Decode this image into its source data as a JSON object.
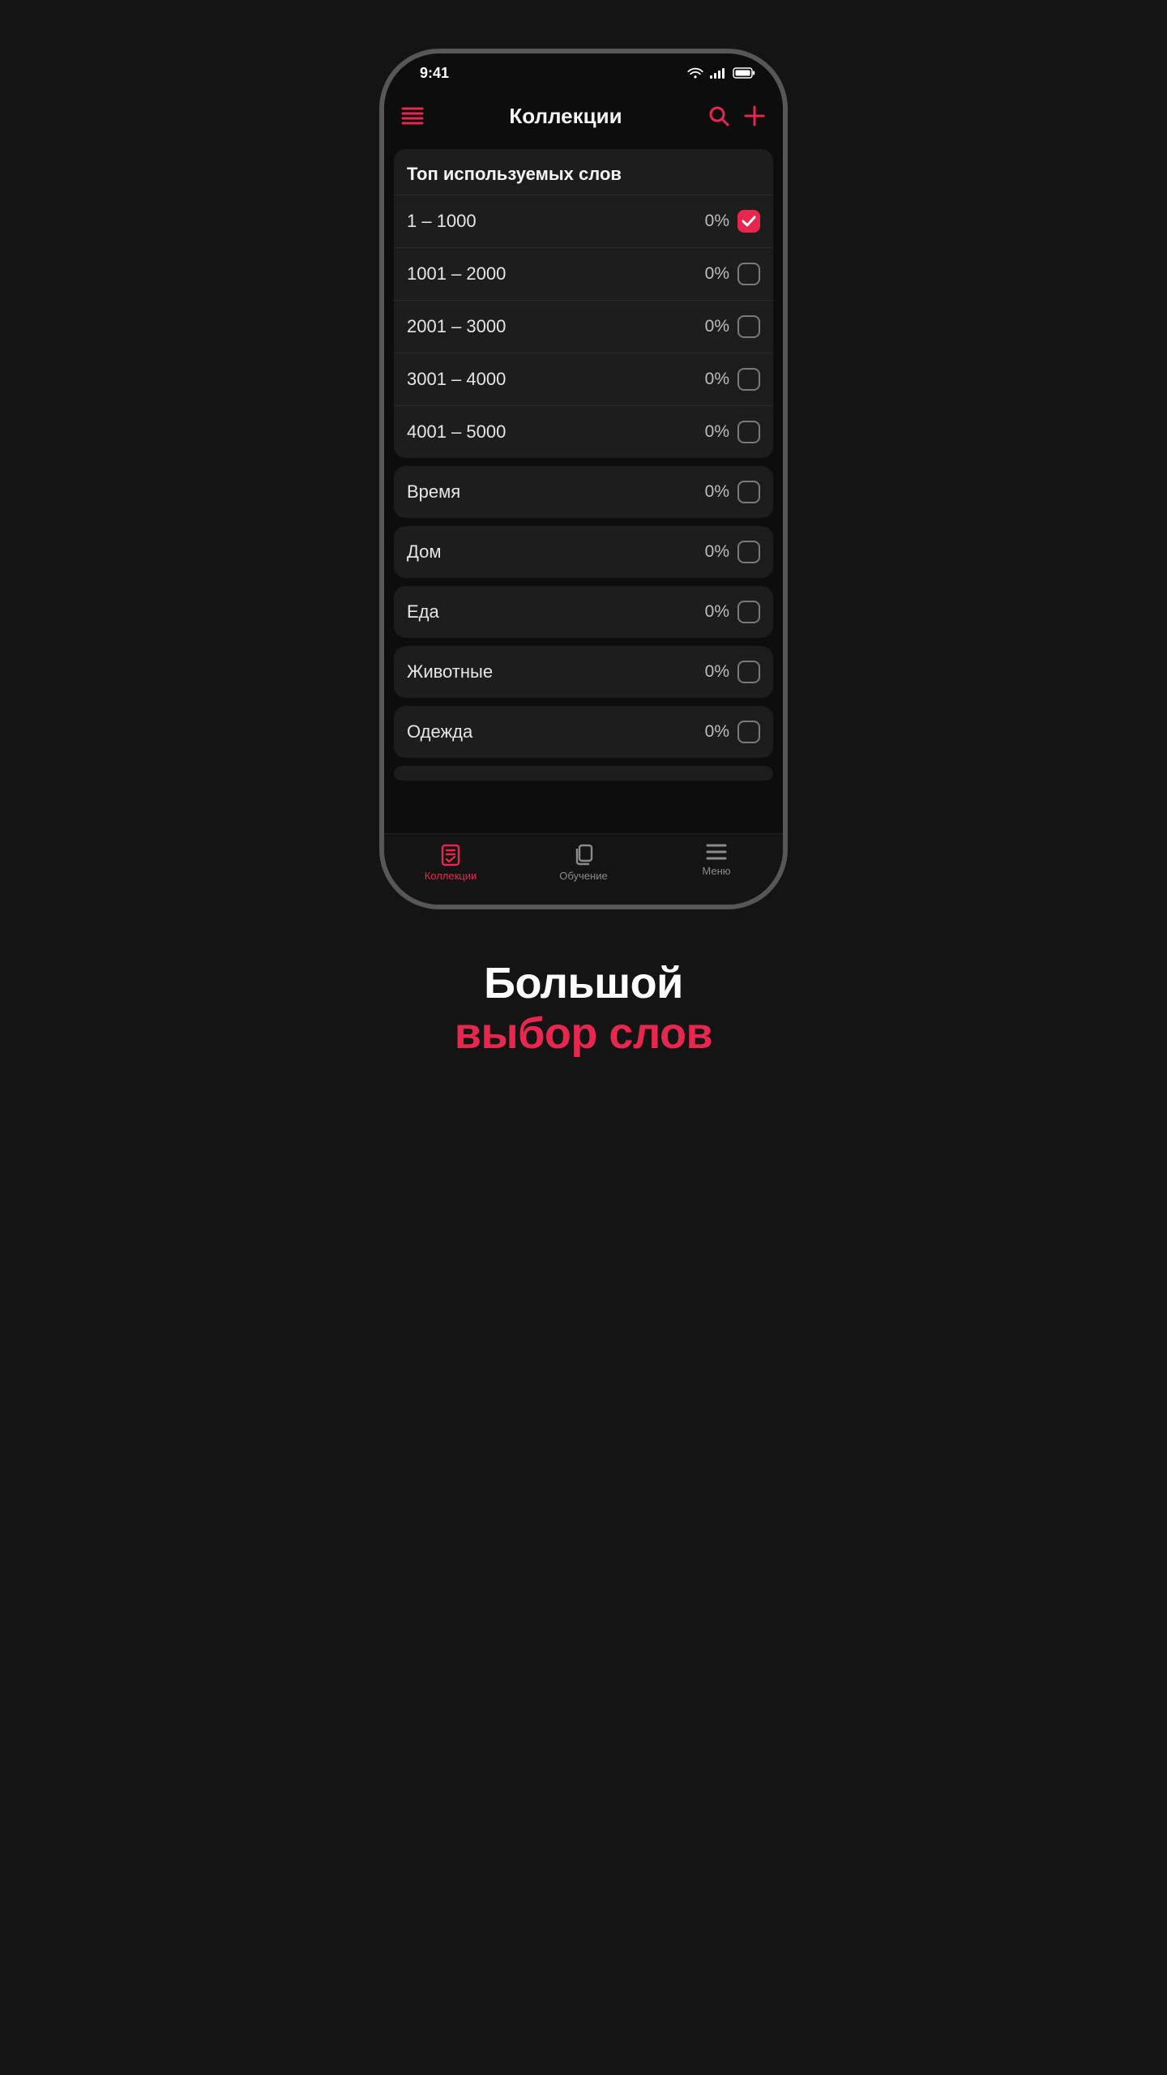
{
  "colors": {
    "accent": "#e8274e",
    "bg": "#141414",
    "card": "#1d1d1d"
  },
  "statusbar": {
    "time": "9:41"
  },
  "header": {
    "title": "Коллекции",
    "menu_icon": "hamburger-icon",
    "search_icon": "search-icon",
    "add_icon": "plus-icon"
  },
  "section_top": {
    "title": "Топ используемых слов",
    "rows": [
      {
        "label": "1 – 1000",
        "pct": "0%",
        "checked": true
      },
      {
        "label": "1001 – 2000",
        "pct": "0%",
        "checked": false
      },
      {
        "label": "2001 – 3000",
        "pct": "0%",
        "checked": false
      },
      {
        "label": "3001 – 4000",
        "pct": "0%",
        "checked": false
      },
      {
        "label": "4001 – 5000",
        "pct": "0%",
        "checked": false
      }
    ]
  },
  "singles": [
    {
      "label": "Время",
      "pct": "0%",
      "checked": false
    },
    {
      "label": "Дом",
      "pct": "0%",
      "checked": false
    },
    {
      "label": "Еда",
      "pct": "0%",
      "checked": false
    },
    {
      "label": "Животные",
      "pct": "0%",
      "checked": false
    },
    {
      "label": "Одежда",
      "pct": "0%",
      "checked": false
    }
  ],
  "tabs": [
    {
      "label": "Коллекции",
      "icon": "collections-icon",
      "active": true
    },
    {
      "label": "Обучение",
      "icon": "cards-icon",
      "active": false
    },
    {
      "label": "Меню",
      "icon": "menu-icon",
      "active": false
    }
  ],
  "caption": {
    "line1": "Большой",
    "line2": "выбор слов"
  }
}
